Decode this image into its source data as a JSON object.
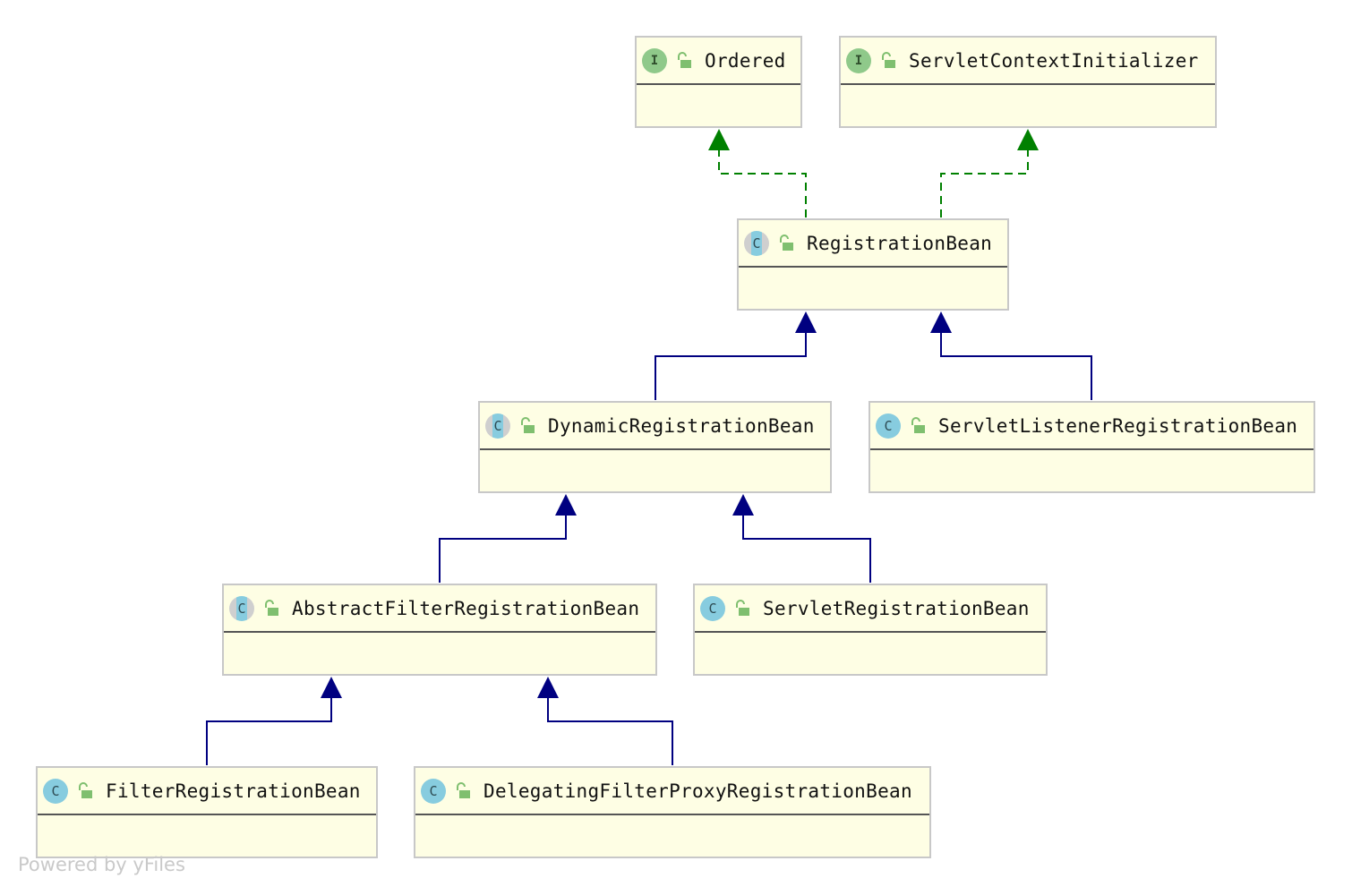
{
  "diagram": {
    "nodes": [
      {
        "id": "ordered",
        "name": "Ordered",
        "kind": "interface",
        "kind_letter": "I"
      },
      {
        "id": "servlet_context_initializer",
        "name": "ServletContextInitializer",
        "kind": "interface",
        "kind_letter": "I"
      },
      {
        "id": "registration_bean",
        "name": "RegistrationBean",
        "kind": "abstract-class",
        "kind_letter": "C"
      },
      {
        "id": "dynamic_registration_bean",
        "name": "DynamicRegistrationBean",
        "kind": "abstract-class",
        "kind_letter": "C"
      },
      {
        "id": "servlet_listener_registration_bean",
        "name": "ServletListenerRegistrationBean",
        "kind": "class",
        "kind_letter": "C"
      },
      {
        "id": "abstract_filter_registration_bean",
        "name": "AbstractFilterRegistrationBean",
        "kind": "abstract-class",
        "kind_letter": "C"
      },
      {
        "id": "servlet_registration_bean",
        "name": "ServletRegistrationBean",
        "kind": "class",
        "kind_letter": "C"
      },
      {
        "id": "filter_registration_bean",
        "name": "FilterRegistrationBean",
        "kind": "class",
        "kind_letter": "C"
      },
      {
        "id": "delegating_filter_proxy_registration_bean",
        "name": "DelegatingFilterProxyRegistrationBean",
        "kind": "class",
        "kind_letter": "C"
      }
    ],
    "edges": [
      {
        "from": "registration_bean",
        "to": "ordered",
        "type": "implements"
      },
      {
        "from": "registration_bean",
        "to": "servlet_context_initializer",
        "type": "implements"
      },
      {
        "from": "dynamic_registration_bean",
        "to": "registration_bean",
        "type": "extends"
      },
      {
        "from": "servlet_listener_registration_bean",
        "to": "registration_bean",
        "type": "extends"
      },
      {
        "from": "abstract_filter_registration_bean",
        "to": "dynamic_registration_bean",
        "type": "extends"
      },
      {
        "from": "servlet_registration_bean",
        "to": "dynamic_registration_bean",
        "type": "extends"
      },
      {
        "from": "filter_registration_bean",
        "to": "abstract_filter_registration_bean",
        "type": "extends"
      },
      {
        "from": "delegating_filter_proxy_registration_bean",
        "to": "abstract_filter_registration_bean",
        "type": "extends"
      }
    ],
    "icons": {
      "interface_icon": "interface-icon",
      "class_icon": "class-icon",
      "abstract_class_icon": "abstract-class-icon",
      "visibility_icon": "public-lock-icon"
    },
    "colors": {
      "node_fill": "#fefee4",
      "node_border": "#c8c8c8",
      "extends_line": "#000080",
      "implements_line": "#008000",
      "interface_badge": "#8fc98a",
      "class_badge": "#87ccdf"
    }
  },
  "watermark": "Powered by yFiles"
}
